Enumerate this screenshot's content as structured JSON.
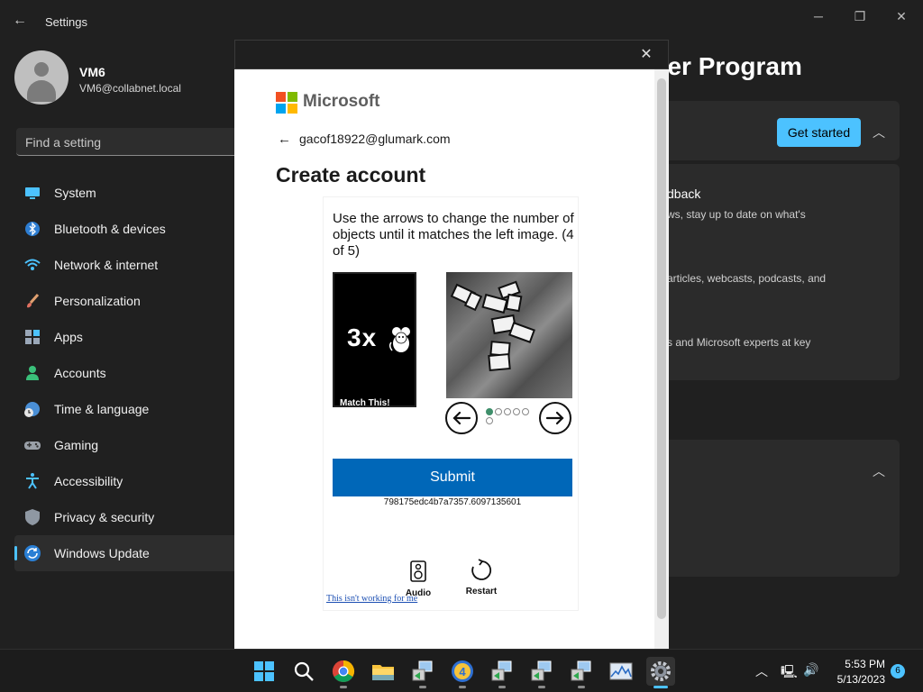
{
  "window": {
    "title": "Settings",
    "controls": {
      "minimize": "─",
      "maximize": "❐",
      "close": "✕"
    }
  },
  "user": {
    "name": "VM6",
    "email": "VM6@collabnet.local"
  },
  "search": {
    "placeholder": "Find a setting"
  },
  "sidebar": {
    "items": [
      {
        "label": "System",
        "icon": "system-icon"
      },
      {
        "label": "Bluetooth & devices",
        "icon": "bluetooth-icon"
      },
      {
        "label": "Network & internet",
        "icon": "network-icon"
      },
      {
        "label": "Personalization",
        "icon": "brush-icon"
      },
      {
        "label": "Apps",
        "icon": "apps-icon"
      },
      {
        "label": "Accounts",
        "icon": "person-icon"
      },
      {
        "label": "Time & language",
        "icon": "clock-globe-icon"
      },
      {
        "label": "Gaming",
        "icon": "gamepad-icon"
      },
      {
        "label": "Accessibility",
        "icon": "accessibility-icon"
      },
      {
        "label": "Privacy & security",
        "icon": "shield-icon"
      },
      {
        "label": "Windows Update",
        "icon": "update-icon",
        "active": true
      }
    ]
  },
  "main": {
    "title_fragment": "sider Program",
    "get_started": "Get started",
    "text_1": "dback",
    "text_2": "ws, stay up to date on what's",
    "text_3": "articles, webcasts, podcasts, and",
    "text_4": "s and Microsoft experts at key"
  },
  "dialog": {
    "close": "✕",
    "brand": "Microsoft",
    "back_arrow": "←",
    "email": "gacof18922@glumark.com",
    "title": "Create account",
    "puzzle": {
      "instruction": "Use the arrows to change the number of objects until it matches the left image. (4 of 5)",
      "target_count": "3x",
      "target_caption": "Match This!",
      "progress_total": 6,
      "progress_current": 1,
      "submit": "Submit",
      "session_id": "798175edc4b7a7357.6097135601",
      "audio": "Audio",
      "restart": "Restart",
      "help_link": "This isn't working for me"
    }
  },
  "taskbar": {
    "time": "5:53 PM",
    "date": "5/13/2023",
    "notifications": "6"
  },
  "colors": {
    "accent": "#4cc2ff",
    "ms_blue": "#0067b8",
    "ms_red": "#f25022",
    "ms_green": "#7fba00",
    "ms_blue_sq": "#00a4ef",
    "ms_yellow": "#ffb900"
  }
}
